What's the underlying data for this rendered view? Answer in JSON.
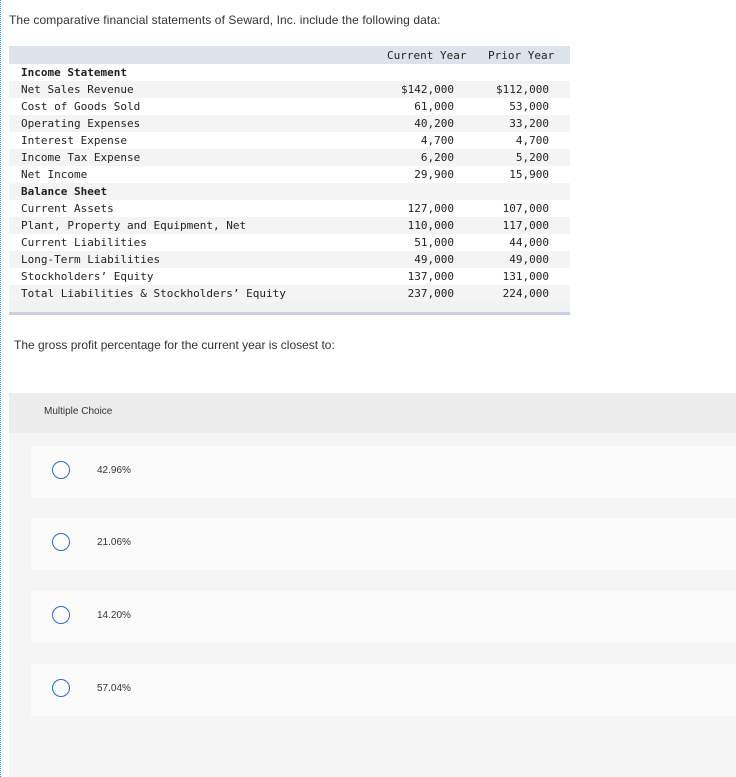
{
  "intro": "The comparative financial statements of Seward, Inc. include the following data:",
  "table": {
    "col_current": "Current Year",
    "col_prior": "Prior Year",
    "rows": [
      {
        "label": "Income Statement",
        "current": "",
        "prior": ""
      },
      {
        "label": "Net Sales Revenue",
        "current": "$142,000",
        "prior": "$112,000"
      },
      {
        "label": "Cost of Goods Sold",
        "current": "61,000",
        "prior": "53,000"
      },
      {
        "label": "Operating Expenses",
        "current": "40,200",
        "prior": "33,200"
      },
      {
        "label": "Interest Expense",
        "current": "4,700",
        "prior": "4,700"
      },
      {
        "label": "Income Tax Expense",
        "current": "6,200",
        "prior": "5,200"
      },
      {
        "label": "Net Income",
        "current": "29,900",
        "prior": "15,900"
      },
      {
        "label": "Balance Sheet",
        "current": "",
        "prior": ""
      },
      {
        "label": "Current Assets",
        "current": "127,000",
        "prior": "107,000"
      },
      {
        "label": "Plant, Property and Equipment, Net",
        "current": "110,000",
        "prior": "117,000"
      },
      {
        "label": "Current Liabilities",
        "current": "51,000",
        "prior": "44,000"
      },
      {
        "label": "Long-Term Liabilities",
        "current": "49,000",
        "prior": "49,000"
      },
      {
        "label": "Stockholders’ Equity",
        "current": "137,000",
        "prior": "131,000"
      },
      {
        "label": "Total Liabilities & Stockholders’ Equity",
        "current": "237,000",
        "prior": "224,000"
      }
    ]
  },
  "question": "The gross profit percentage for the current year is closest to:",
  "multiple_choice": {
    "title": "Multiple Choice",
    "options": [
      {
        "label": "42.96%",
        "selected": false
      },
      {
        "label": "21.06%",
        "selected": false
      },
      {
        "label": "14.20%",
        "selected": false
      },
      {
        "label": "57.04%",
        "selected": false
      }
    ]
  },
  "colors": {
    "radio_border": "#2a6bd1",
    "table_header_band": "#dde3ea",
    "left_rule": "#3f7fc9"
  }
}
